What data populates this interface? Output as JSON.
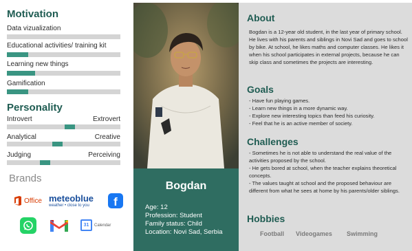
{
  "motivation": {
    "title": "Motivation",
    "items": [
      {
        "label": "Data vizualization",
        "value": 0
      },
      {
        "label": "Educational activities/ training kit",
        "value": 0.19
      },
      {
        "label": "Learning new things",
        "value": 0.25
      },
      {
        "label": "Gamification",
        "value": 0.19
      }
    ]
  },
  "personality": {
    "title": "Personality",
    "traits": [
      {
        "left": "Introvert",
        "right": "Extrovert",
        "value": 0.56
      },
      {
        "left": "Analytical",
        "right": "Creative",
        "value": 0.44
      },
      {
        "left": "Judging",
        "right": "Perceiving",
        "value": 0.32
      }
    ]
  },
  "brands": {
    "title": "Brands",
    "office": "Office",
    "meteoblue": "meteoblue",
    "meteoblue_tagline": "weather • close to you",
    "facebook": "f",
    "calendar": "Calendar",
    "calendar_day": "31"
  },
  "profile": {
    "name": "Bogdan",
    "age": "Age: 12",
    "profession": "Profession: Student",
    "family": "Family status: Child",
    "location": "Location: Novi Sad, Serbia"
  },
  "about": {
    "title": "About",
    "text": "Bogdan is a 12-year old student, in the last year of primary school. He lives with his parents and siblings in Novi Sad and goes to school by bike. At school, he likes maths and computer classes. He likes it when his school participates in external projects, because he can skip class and sometimes the projects are interesting."
  },
  "goals": {
    "title": "Goals",
    "items": [
      "- Have fun playing games.",
      "- Learn new things in a more dynamic way.",
      "- Explore new interesting topics than feed his curiosity.",
      "- Feel that he is an active member of society."
    ]
  },
  "challenges": {
    "title": "Challenges",
    "items": [
      "- Sometimes he is not able to understand the real value of the activities proposed by the school.",
      "- He gets bored at school, when the teacher explains theoretical concepts.",
      "- The values taught at school and the proposed behaviour are different from what he sees at home by his parents/older siblings."
    ]
  },
  "hobbies": {
    "title": "Hobbies",
    "items": [
      "Football",
      "Videogames",
      "Swimming"
    ]
  },
  "colors": {
    "accent": "#1f5c52",
    "bar_fill": "#3a9582",
    "bar_track": "#d4d4d4",
    "profile_bg": "#2f6d61",
    "panel_bg": "#dcdcdc"
  }
}
